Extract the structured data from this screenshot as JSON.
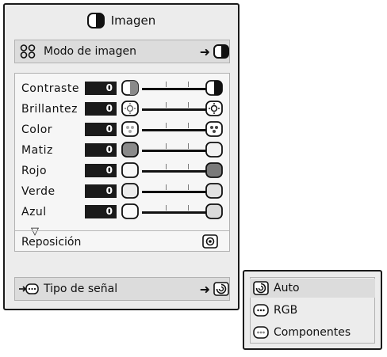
{
  "menu": {
    "title": "Imagen",
    "picture_mode": {
      "label": "Modo de imagen"
    },
    "adjustments": [
      {
        "label": "Contraste",
        "value": "0",
        "left_icon": "contrast-low-icon",
        "right_icon": "contrast-high-icon"
      },
      {
        "label": "Brillantez",
        "value": "0",
        "left_icon": "brightness-low-icon",
        "right_icon": "brightness-high-icon"
      },
      {
        "label": "Color",
        "value": "0",
        "left_icon": "color-low-icon",
        "right_icon": "color-high-icon"
      },
      {
        "label": "Matiz",
        "value": "0",
        "left_icon": "tint-dark-icon",
        "right_icon": "tint-light-icon"
      },
      {
        "label": "Rojo",
        "value": "0",
        "left_icon": "red-light-icon",
        "right_icon": "red-dark-icon"
      },
      {
        "label": "Verde",
        "value": "0",
        "left_icon": "green-light-icon",
        "right_icon": "green-dark-icon"
      },
      {
        "label": "Azul",
        "value": "0",
        "left_icon": "blue-light-icon",
        "right_icon": "blue-dark-icon"
      }
    ],
    "reset_label": "Reposición",
    "signal_type": {
      "label": "Tipo de señal"
    }
  },
  "signal_popup": {
    "options": [
      {
        "label": "Auto",
        "icon": "auto-signal-icon",
        "selected": true
      },
      {
        "label": "RGB",
        "icon": "rgb-signal-icon",
        "selected": false
      },
      {
        "label": "Componentes",
        "icon": "component-signal-icon",
        "selected": false
      }
    ]
  }
}
